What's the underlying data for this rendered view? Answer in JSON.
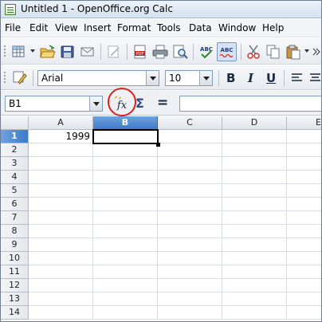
{
  "window": {
    "title": "Untitled 1 - OpenOffice.org Calc"
  },
  "menubar": {
    "items": [
      {
        "label": "File"
      },
      {
        "label": "Edit"
      },
      {
        "label": "View"
      },
      {
        "label": "Insert"
      },
      {
        "label": "Format"
      },
      {
        "label": "Tools"
      },
      {
        "label": "Data"
      },
      {
        "label": "Window"
      },
      {
        "label": "Help"
      }
    ]
  },
  "toolbar_standard": {
    "icons": [
      "new-document-icon",
      "open-folder-icon",
      "save-icon",
      "email-icon",
      "edit-file-icon",
      "export-pdf-icon",
      "print-icon",
      "page-preview-icon",
      "spellcheck-icon",
      "autospellcheck-icon",
      "cut-icon",
      "copy-icon",
      "paste-icon"
    ]
  },
  "toolbar_format": {
    "font_name": "Arial",
    "font_size": "10",
    "bold_label": "B",
    "italic_label": "I",
    "underline_label": "U"
  },
  "formula_bar": {
    "cell_reference": "B1",
    "function_wizard_label": "fx",
    "sum_label": "Σ",
    "function_label": "=",
    "formula_value": ""
  },
  "sheet": {
    "columns": [
      "A",
      "B",
      "C",
      "D",
      "E"
    ],
    "active_column": "B",
    "rows": [
      "1",
      "2",
      "3",
      "4",
      "5",
      "6",
      "7",
      "8",
      "9",
      "10",
      "11",
      "12",
      "13",
      "14"
    ],
    "active_row": "1",
    "cells": {
      "A1": "1999",
      "B1": ""
    },
    "selected_cell": "B1"
  },
  "colors": {
    "selection_header": "#3f7ac9",
    "highlight_circle": "#d92020"
  }
}
